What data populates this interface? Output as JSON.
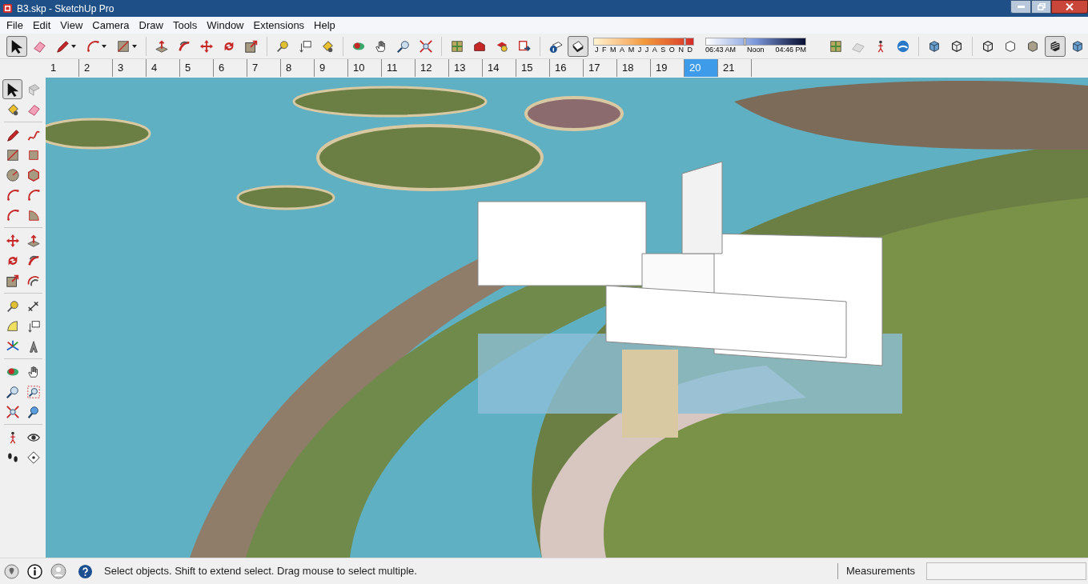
{
  "window": {
    "title": "B3.skp - SketchUp Pro"
  },
  "menu": [
    "File",
    "Edit",
    "View",
    "Camera",
    "Draw",
    "Tools",
    "Window",
    "Extensions",
    "Help"
  ],
  "toolbar": [
    {
      "kind": "select",
      "selected": true
    },
    {
      "kind": "eraser",
      "selected": false
    },
    {
      "kind": "pencil",
      "selected": false,
      "dropdown": true
    },
    {
      "kind": "arc",
      "selected": false,
      "dropdown": true
    },
    {
      "kind": "rectangle",
      "selected": false,
      "dropdown": true
    },
    {
      "kind": "separator"
    },
    {
      "kind": "pushpull",
      "selected": false
    },
    {
      "kind": "followme",
      "selected": false
    },
    {
      "kind": "move",
      "selected": false
    },
    {
      "kind": "rotate",
      "selected": false
    },
    {
      "kind": "scale",
      "selected": false
    },
    {
      "kind": "separator"
    },
    {
      "kind": "tape",
      "selected": false
    },
    {
      "kind": "text",
      "selected": false
    },
    {
      "kind": "paint",
      "selected": false
    },
    {
      "kind": "separator"
    },
    {
      "kind": "orbit",
      "selected": false
    },
    {
      "kind": "pan",
      "selected": false
    },
    {
      "kind": "zoom",
      "selected": false
    },
    {
      "kind": "zoomextents",
      "selected": false
    },
    {
      "kind": "separator"
    },
    {
      "kind": "map",
      "selected": false
    },
    {
      "kind": "warehouse",
      "selected": false
    },
    {
      "kind": "components",
      "selected": false
    },
    {
      "kind": "export",
      "selected": false
    },
    {
      "kind": "separator"
    },
    {
      "kind": "shadowinfo",
      "selected": false
    },
    {
      "kind": "shadows",
      "selected": true
    }
  ],
  "shadow_settings": {
    "months": [
      "J",
      "F",
      "M",
      "A",
      "M",
      "J",
      "J",
      "A",
      "S",
      "O",
      "N",
      "D"
    ],
    "month_slider": {
      "level": 0.9
    },
    "time_start": "06:43 AM",
    "time_mid": "Noon",
    "time_end": "04:46 PM",
    "time_slider": {
      "level": 0.38
    }
  },
  "toolbar_right": [
    {
      "kind": "map",
      "selected": false
    },
    {
      "kind": "terrain",
      "selected": false
    },
    {
      "kind": "person",
      "selected": false
    },
    {
      "kind": "globe",
      "selected": false
    },
    {
      "kind": "separator"
    },
    {
      "kind": "cube",
      "selected": false
    },
    {
      "kind": "wirecube",
      "selected": false
    },
    {
      "kind": "separator"
    },
    {
      "kind": "wirecube",
      "selected": false
    },
    {
      "kind": "hidden",
      "selected": false
    },
    {
      "kind": "shaded",
      "selected": false
    },
    {
      "kind": "textured",
      "selected": true
    },
    {
      "kind": "cube",
      "selected": false
    }
  ],
  "scenes": [
    {
      "label": "1",
      "selected": false
    },
    {
      "label": "2",
      "selected": false
    },
    {
      "label": "3",
      "selected": false
    },
    {
      "label": "4",
      "selected": false
    },
    {
      "label": "5",
      "selected": false
    },
    {
      "label": "6",
      "selected": false
    },
    {
      "label": "7",
      "selected": false
    },
    {
      "label": "8",
      "selected": false
    },
    {
      "label": "9",
      "selected": false
    },
    {
      "label": "10",
      "selected": false
    },
    {
      "label": "11",
      "selected": false
    },
    {
      "label": "12",
      "selected": false
    },
    {
      "label": "13",
      "selected": false
    },
    {
      "label": "14",
      "selected": false
    },
    {
      "label": "15",
      "selected": false
    },
    {
      "label": "16",
      "selected": false
    },
    {
      "label": "17",
      "selected": false
    },
    {
      "label": "18",
      "selected": false
    },
    {
      "label": "19",
      "selected": false
    },
    {
      "label": "20",
      "selected": true
    },
    {
      "label": "21",
      "selected": false
    }
  ],
  "left_toolbar": [
    {
      "kind": "row",
      "tools": [
        {
          "kind": "select",
          "selected": true
        },
        {
          "kind": "component",
          "selected": false
        }
      ]
    },
    {
      "kind": "row",
      "tools": [
        {
          "kind": "paint",
          "selected": false
        },
        {
          "kind": "eraser",
          "selected": false
        }
      ]
    },
    {
      "kind": "separator"
    },
    {
      "kind": "row",
      "tools": [
        {
          "kind": "pencil",
          "selected": false
        },
        {
          "kind": "freehand",
          "selected": false
        }
      ]
    },
    {
      "kind": "row",
      "tools": [
        {
          "kind": "rectangle",
          "selected": false
        },
        {
          "kind": "rotrect",
          "selected": false
        }
      ]
    },
    {
      "kind": "row",
      "tools": [
        {
          "kind": "circle",
          "selected": false
        },
        {
          "kind": "polygon",
          "selected": false
        }
      ]
    },
    {
      "kind": "row",
      "tools": [
        {
          "kind": "arc",
          "selected": false
        },
        {
          "kind": "arc",
          "selected": false
        }
      ]
    },
    {
      "kind": "row",
      "tools": [
        {
          "kind": "arc",
          "selected": false
        },
        {
          "kind": "pie",
          "selected": false
        }
      ]
    },
    {
      "kind": "separator"
    },
    {
      "kind": "row",
      "tools": [
        {
          "kind": "move",
          "selected": false
        },
        {
          "kind": "pushpull",
          "selected": false
        }
      ]
    },
    {
      "kind": "row",
      "tools": [
        {
          "kind": "rotate",
          "selected": false
        },
        {
          "kind": "followme",
          "selected": false
        }
      ]
    },
    {
      "kind": "row",
      "tools": [
        {
          "kind": "scale",
          "selected": false
        },
        {
          "kind": "offset",
          "selected": false
        }
      ]
    },
    {
      "kind": "separator"
    },
    {
      "kind": "row",
      "tools": [
        {
          "kind": "tape",
          "selected": false
        },
        {
          "kind": "dimension",
          "selected": false
        }
      ]
    },
    {
      "kind": "row",
      "tools": [
        {
          "kind": "protractor",
          "selected": false
        },
        {
          "kind": "text",
          "selected": false
        }
      ]
    },
    {
      "kind": "row",
      "tools": [
        {
          "kind": "axes",
          "selected": false
        },
        {
          "kind": "text3d",
          "selected": false
        }
      ]
    },
    {
      "kind": "separator"
    },
    {
      "kind": "row",
      "tools": [
        {
          "kind": "orbit",
          "selected": false
        },
        {
          "kind": "pan",
          "selected": false
        }
      ]
    },
    {
      "kind": "row",
      "tools": [
        {
          "kind": "zoom",
          "selected": false
        },
        {
          "kind": "zoomwindow",
          "selected": false
        }
      ]
    },
    {
      "kind": "row",
      "tools": [
        {
          "kind": "zoomextents",
          "selected": false
        },
        {
          "kind": "previous",
          "selected": false
        }
      ]
    },
    {
      "kind": "separator"
    },
    {
      "kind": "row",
      "tools": [
        {
          "kind": "person",
          "selected": false
        },
        {
          "kind": "eye",
          "selected": false
        }
      ]
    },
    {
      "kind": "row",
      "tools": [
        {
          "kind": "footprints",
          "selected": false
        },
        {
          "kind": "section",
          "selected": false
        }
      ]
    }
  ],
  "status_bar": {
    "hint": "Select objects. Shift to extend select. Drag mouse to select multiple.",
    "measurements_label": "Measurements"
  }
}
